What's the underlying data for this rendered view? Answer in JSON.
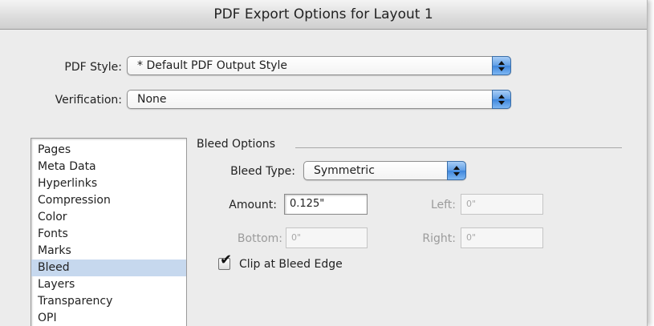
{
  "window": {
    "title": "PDF Export Options for Layout 1"
  },
  "pdf_style": {
    "label": "PDF Style:",
    "value": "* Default PDF Output Style"
  },
  "verification": {
    "label": "Verification:",
    "value": "None"
  },
  "categories": {
    "items": [
      "Pages",
      "Meta Data",
      "Hyperlinks",
      "Compression",
      "Color",
      "Fonts",
      "Marks",
      "Bleed",
      "Layers",
      "Transparency",
      "OPI"
    ],
    "selected": "Bleed"
  },
  "bleed_options": {
    "group_title": "Bleed Options",
    "bleed_type_label": "Bleed Type:",
    "bleed_type_value": "Symmetric",
    "amount_label": "Amount:",
    "amount_value": "0.125\"",
    "left_label": "Left:",
    "left_value": "0\"",
    "bottom_label": "Bottom:",
    "bottom_value": "0\"",
    "right_label": "Right:",
    "right_value": "0\"",
    "clip_label": "Clip at Bleed Edge",
    "clip_checked": true
  },
  "icons": {
    "stepper": "up-down-arrows-icon",
    "checkmark": "checkmark-icon"
  },
  "colors": {
    "selection": "#c6d8ee",
    "stepper_blue": "#5f9ee6",
    "disabled_text": "#9b9b9b"
  }
}
